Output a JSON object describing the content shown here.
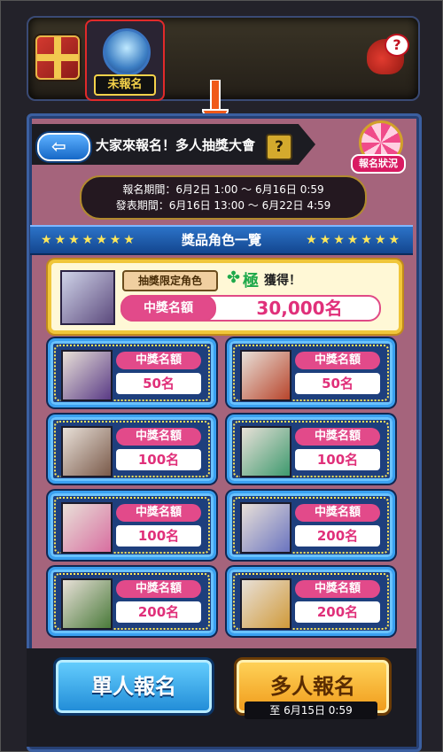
{
  "header": {
    "gift_icon": "gift-box-icon",
    "entry_badge_label": "未報名",
    "help_icon": "help-mascot-icon",
    "help_glyph": "?"
  },
  "title_bar": {
    "back_glyph": "⇦",
    "title": "大家來報名！多人抽獎大會",
    "help_glyph": "?"
  },
  "status_button": {
    "label": "報名狀況"
  },
  "period": {
    "entry": "報名期間：6月2日 1:00 〜 6月16日 0:59",
    "announce": "發表期間：6月16日 13:00 〜 6月22日 4:59"
  },
  "section": {
    "title": "獎品角色一覽",
    "stars": "★★★★★★★"
  },
  "grand_prize": {
    "tag": "抽獎限定角色",
    "clover": "✤",
    "kiwami": "極",
    "obtain": "獲得！",
    "winners_label": "中獎名額",
    "winners_value": "30,000名"
  },
  "prizes": [
    {
      "label": "中獎名額",
      "value": "50名",
      "color": "#5a3b86"
    },
    {
      "label": "中獎名額",
      "value": "50名",
      "color": "#b8452c"
    },
    {
      "label": "中獎名額",
      "value": "100名",
      "color": "#7a5a4a"
    },
    {
      "label": "中獎名額",
      "value": "100名",
      "color": "#3e9a6e"
    },
    {
      "label": "中獎名額",
      "value": "100名",
      "color": "#d86ea0"
    },
    {
      "label": "中獎名額",
      "value": "200名",
      "color": "#6a74c0"
    },
    {
      "label": "中獎名額",
      "value": "200名",
      "color": "#4a7a3a"
    },
    {
      "label": "中獎名額",
      "value": "200名",
      "color": "#d09a3a"
    }
  ],
  "actions": {
    "single": "單人報名",
    "multi": "多人報名",
    "deadline": "至 6月15日 0:59"
  }
}
